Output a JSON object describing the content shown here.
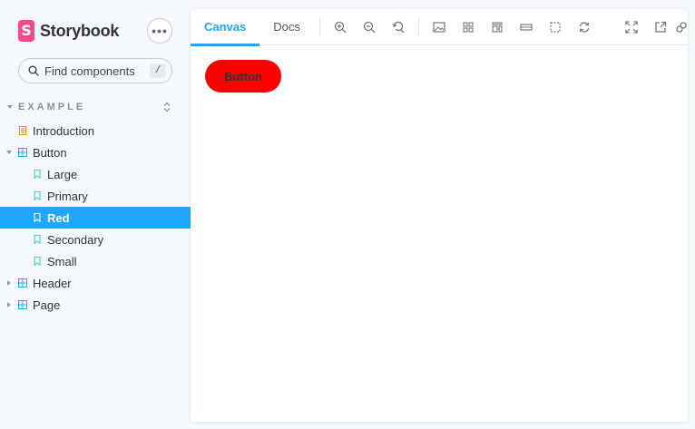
{
  "sidebar": {
    "brand": {
      "logo_letter": "S",
      "name": "Storybook"
    },
    "menu_label": "•••",
    "search": {
      "placeholder": "Find components",
      "shortcut": "/"
    },
    "group": {
      "label": "EXAMPLE"
    },
    "tree": [
      {
        "label": "Introduction",
        "type": "doc",
        "level": 1
      },
      {
        "label": "Button",
        "type": "component",
        "level": 1,
        "expanded": true
      },
      {
        "label": "Large",
        "type": "story",
        "level": 2
      },
      {
        "label": "Primary",
        "type": "story",
        "level": 2
      },
      {
        "label": "Red",
        "type": "story",
        "level": 2,
        "selected": true
      },
      {
        "label": "Secondary",
        "type": "story",
        "level": 2
      },
      {
        "label": "Small",
        "type": "story",
        "level": 2
      },
      {
        "label": "Header",
        "type": "component",
        "level": 1,
        "expanded": false
      },
      {
        "label": "Page",
        "type": "component",
        "level": 1,
        "expanded": false
      }
    ]
  },
  "toolbar": {
    "tabs": [
      {
        "label": "Canvas",
        "active": true
      },
      {
        "label": "Docs",
        "active": false
      }
    ],
    "tools": [
      "zoom-in-icon",
      "zoom-out-icon",
      "zoom-reset-icon",
      "background-icon",
      "grid-icon",
      "viewport-icon",
      "measure-icon",
      "outline-icon",
      "remount-icon"
    ],
    "right_tools": [
      "fullscreen-icon",
      "open-new-tab-icon",
      "copy-link-icon"
    ]
  },
  "canvas": {
    "button_label": "Button"
  },
  "colors": {
    "accent": "#1ea7fd",
    "brand": "#ff4785",
    "demo_button": "#ff0000",
    "doc_icon": "#ff8b00",
    "component_icon": "#1ea7fd",
    "story_icon": "#37d5d3"
  }
}
